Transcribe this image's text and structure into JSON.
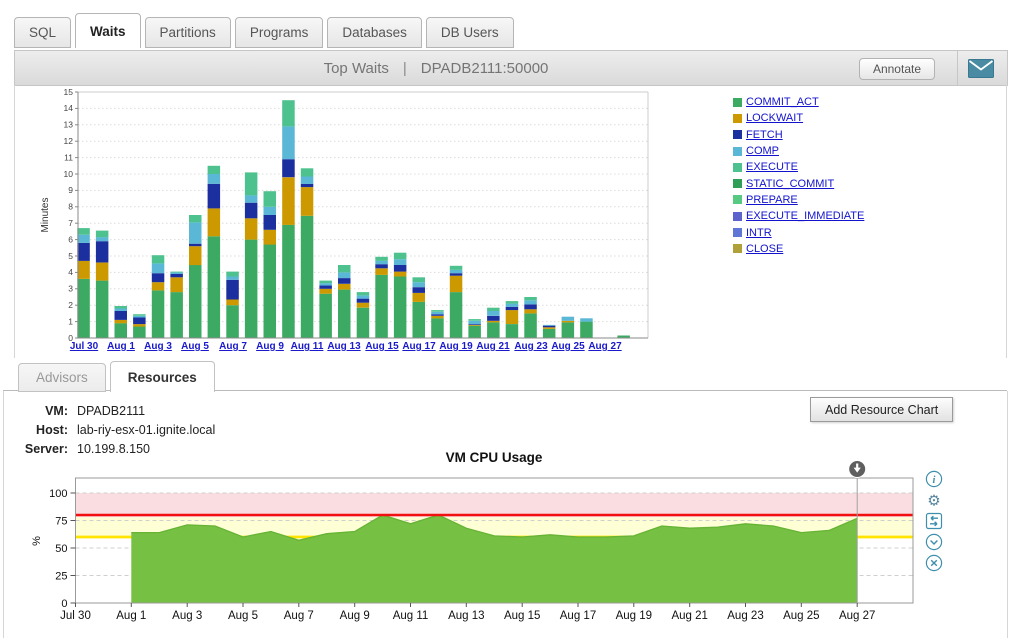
{
  "main_tabs": {
    "items": [
      {
        "label": "SQL",
        "active": false
      },
      {
        "label": "Waits",
        "active": true
      },
      {
        "label": "Partitions",
        "active": false
      },
      {
        "label": "Programs",
        "active": false
      },
      {
        "label": "Databases",
        "active": false
      },
      {
        "label": "DB Users",
        "active": false
      }
    ]
  },
  "header": {
    "title_left": "Top Waits",
    "separator": "|",
    "title_right": "DPADB2111:50000",
    "annotate_label": "Annotate",
    "envelope_icon": "email-envelope-icon",
    "envelope_color": "#4a8ba4"
  },
  "resources": {
    "tabs": [
      {
        "label": "Advisors",
        "active": false
      },
      {
        "label": "Resources",
        "active": true
      }
    ],
    "vm_info": [
      {
        "label": "VM:",
        "value": "DPADB2111"
      },
      {
        "label": "Host:",
        "value": "lab-riy-esx-01.ignite.local"
      },
      {
        "label": "Server:",
        "value": "10.199.8.150"
      }
    ],
    "add_button_label": "Add Resource Chart",
    "chart_icons": [
      {
        "name": "info-circle-icon"
      },
      {
        "name": "gear-icon"
      },
      {
        "name": "swap-horizontal-icon"
      },
      {
        "name": "chevron-down-circle-icon"
      },
      {
        "name": "close-circle-icon"
      }
    ],
    "icon_color": "#3e8fad"
  },
  "chart_data": [
    {
      "type": "bar",
      "stacked": true,
      "title": "Top Waits | DPADB2111:50000",
      "ylabel": "Minutes",
      "ylim": [
        0,
        15
      ],
      "grid": "dotted-horizontal",
      "legend_position": "right",
      "categories": [
        "Jul 30",
        "Jul 31",
        "Aug 1",
        "Aug 2",
        "Aug 3",
        "Aug 4",
        "Aug 5",
        "Aug 6",
        "Aug 7",
        "Aug 8",
        "Aug 9",
        "Aug 10",
        "Aug 11",
        "Aug 12",
        "Aug 13",
        "Aug 14",
        "Aug 15",
        "Aug 16",
        "Aug 17",
        "Aug 18",
        "Aug 19",
        "Aug 20",
        "Aug 21",
        "Aug 22",
        "Aug 23",
        "Aug 24",
        "Aug 25",
        "Aug 26",
        "Aug 27",
        "Aug 28"
      ],
      "x_tick_labels": [
        "Jul 30",
        "Aug 1",
        "Aug 3",
        "Aug 5",
        "Aug 7",
        "Aug 9",
        "Aug 11",
        "Aug 13",
        "Aug 15",
        "Aug 17",
        "Aug 19",
        "Aug 21",
        "Aug 23",
        "Aug 25",
        "Aug 27"
      ],
      "series": [
        {
          "name": "COMMIT_ACT",
          "color": "#3caa63",
          "values": [
            3.6,
            3.5,
            0.9,
            0.7,
            2.9,
            2.8,
            4.45,
            6.2,
            2.0,
            6.0,
            5.7,
            6.9,
            7.45,
            2.7,
            2.95,
            1.85,
            3.85,
            3.75,
            2.2,
            1.2,
            2.8,
            0.75,
            0.95,
            0.85,
            1.5,
            0.55,
            0.95,
            1.0,
            0,
            0.15
          ]
        },
        {
          "name": "LOCKWAIT",
          "color": "#cc9a00",
          "values": [
            1.1,
            1.1,
            0.2,
            0.15,
            0.5,
            0.9,
            1.15,
            1.7,
            0.35,
            1.3,
            0.9,
            2.9,
            1.75,
            0.3,
            0.35,
            0.3,
            0.4,
            0.3,
            0.55,
            0.15,
            1.0,
            0.05,
            0.1,
            0.85,
            0.25,
            0.1,
            0.1,
            0,
            0,
            0
          ]
        },
        {
          "name": "FETCH",
          "color": "#1c2f9e",
          "values": [
            1.1,
            1.3,
            0.55,
            0.4,
            0.55,
            0.2,
            0.15,
            1.5,
            1.2,
            0.95,
            0.9,
            1.1,
            0.2,
            0.2,
            0.35,
            0.25,
            0.25,
            0.4,
            0.35,
            0.1,
            0.15,
            0.05,
            0.3,
            0.2,
            0.3,
            0.1,
            0,
            0,
            0,
            0
          ]
        },
        {
          "name": "COMP",
          "color": "#5bb7d6",
          "values": [
            0.5,
            0.25,
            0.15,
            0.1,
            0.6,
            0.1,
            1.3,
            0.6,
            0.2,
            0.45,
            0.5,
            2.0,
            0.45,
            0.15,
            0.35,
            0.2,
            0.2,
            0.35,
            0.3,
            0.15,
            0.2,
            0.2,
            0.3,
            0.2,
            0.25,
            0.05,
            0.25,
            0.2,
            0,
            0
          ]
        },
        {
          "name": "EXECUTE",
          "color": "#4ec28e",
          "values": [
            0.4,
            0.4,
            0.15,
            0.1,
            0.5,
            0.05,
            0.45,
            0.5,
            0.3,
            1.4,
            0.95,
            1.6,
            0.5,
            0.15,
            0.45,
            0.2,
            0.25,
            0.4,
            0.3,
            0.1,
            0.25,
            0.1,
            0.2,
            0.15,
            0.2,
            0,
            0,
            0,
            0,
            0
          ]
        },
        {
          "name": "STATIC_COMMIT",
          "color": "#2f9e57",
          "values": [
            0,
            0,
            0,
            0,
            0,
            0,
            0,
            0,
            0,
            0,
            0,
            0,
            0,
            0,
            0,
            0,
            0,
            0,
            0,
            0,
            0,
            0,
            0,
            0,
            0,
            0,
            0,
            0,
            0,
            0
          ]
        },
        {
          "name": "PREPARE",
          "color": "#57c981",
          "values": [
            0,
            0,
            0,
            0,
            0,
            0,
            0,
            0,
            0,
            0,
            0,
            0,
            0,
            0,
            0,
            0,
            0,
            0,
            0,
            0,
            0,
            0,
            0,
            0,
            0,
            0,
            0,
            0,
            0,
            0
          ]
        },
        {
          "name": "EXECUTE_IMMEDIATE",
          "color": "#5c63cc",
          "values": [
            0,
            0,
            0,
            0,
            0,
            0,
            0,
            0,
            0,
            0,
            0,
            0,
            0,
            0,
            0,
            0,
            0,
            0,
            0,
            0,
            0,
            0,
            0,
            0,
            0,
            0,
            0,
            0,
            0,
            0
          ]
        },
        {
          "name": "INTR",
          "color": "#5f76d6",
          "values": [
            0,
            0,
            0,
            0,
            0,
            0,
            0,
            0,
            0,
            0,
            0,
            0,
            0,
            0,
            0,
            0,
            0,
            0,
            0,
            0,
            0,
            0,
            0,
            0,
            0,
            0,
            0,
            0,
            0,
            0
          ]
        },
        {
          "name": "CLOSE",
          "color": "#b0a03a",
          "values": [
            0,
            0,
            0,
            0,
            0,
            0,
            0,
            0,
            0,
            0,
            0,
            0,
            0,
            0,
            0,
            0,
            0,
            0,
            0,
            0,
            0,
            0,
            0,
            0,
            0,
            0,
            0,
            0,
            0,
            0
          ]
        }
      ]
    },
    {
      "type": "area",
      "title": "VM CPU Usage",
      "ylabel": "%",
      "ylim": [
        0,
        113
      ],
      "yticks": [
        0,
        25,
        50,
        75,
        100
      ],
      "grid": "dashed-horizontal",
      "x_tick_labels": [
        "Jul 30",
        "Aug 1",
        "Aug 3",
        "Aug 5",
        "Aug 7",
        "Aug 9",
        "Aug 11",
        "Aug 13",
        "Aug 15",
        "Aug 17",
        "Aug 19",
        "Aug 21",
        "Aug 23",
        "Aug 25",
        "Aug 27"
      ],
      "x_days_from_first_tick": [
        2,
        3,
        4,
        5,
        6,
        7,
        8,
        9,
        10,
        11,
        12,
        13,
        14,
        15,
        16,
        17,
        18,
        19,
        20,
        21,
        22,
        23,
        24,
        25,
        26,
        27,
        28
      ],
      "values": [
        64,
        64,
        71,
        70,
        60,
        65,
        57,
        63,
        65,
        80,
        72,
        80,
        68,
        61,
        60,
        62,
        60,
        60,
        61,
        70,
        68,
        69,
        72,
        70,
        64,
        66,
        77
      ],
      "thresholds": {
        "red_line": 80,
        "yellow_line": 60,
        "pink_band": [
          78,
          100
        ],
        "yellow_band": [
          60,
          78
        ]
      },
      "annotation_marker_at": "Aug 27",
      "colors": {
        "area": "#76c043",
        "area_edge": "#66b335",
        "red_line": "#f21111",
        "yellow_line": "#ffe400",
        "pink_band": "#fadde0",
        "yellow_band": "#ffffd6"
      }
    }
  ]
}
